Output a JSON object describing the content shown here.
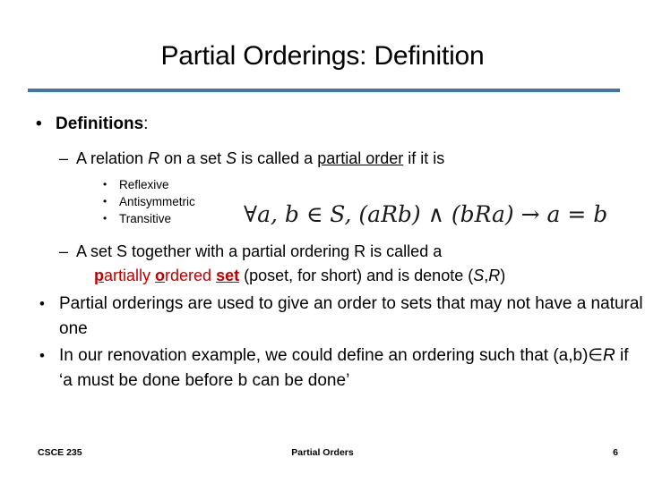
{
  "slide": {
    "title": "Partial Orderings: Definition",
    "accent_color": "#4175a5",
    "highlight_color": "#c00000",
    "bullets": {
      "definitions_label": "Definitions",
      "definitions_colon": ":",
      "relation_line": {
        "part1": "A relation ",
        "r": "R",
        "part2": " on a set ",
        "s": "S",
        "part3": " is called a ",
        "term": "partial order",
        "part4": " if it is"
      },
      "properties": [
        "Reflexive",
        "Antisymmetric",
        "Transitive"
      ],
      "formula": "∀a, b ∈ S, (aRb) ∧ (bRa) → a = b",
      "poset_line": {
        "line1": "A set S together with a partial ordering R is called a",
        "red_p": "p",
        "red_artially": "artially ",
        "red_o": "o",
        "red_rdered": "rdered ",
        "red_set": "set",
        "tail1": " (poset, for short) and is denote (",
        "s": "S",
        "comma": ",",
        "r": "R",
        "tail2": ")"
      },
      "usage_line": "Partial orderings are used to give an order to sets that may not have a natural one",
      "example_line": {
        "part1": "In our renovation example, we could define an ordering such that (a,b)∈",
        "r": "R",
        "part2": " if ‘a must be done before b can be done’"
      }
    },
    "footer": {
      "course": "CSCE 235",
      "topic": "Partial Orders",
      "page_number": "6"
    }
  },
  "icons": {
    "bullet_dot": "•",
    "dash": "–"
  }
}
